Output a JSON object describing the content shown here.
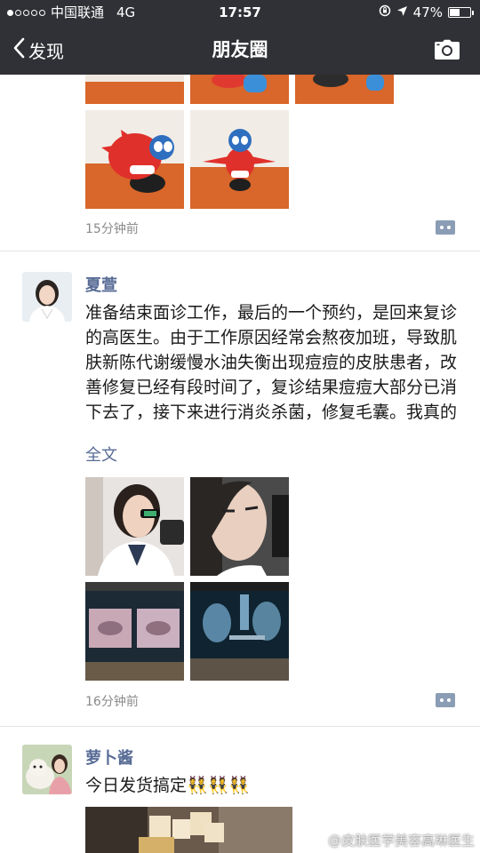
{
  "status_bar": {
    "carrier": "中国联通",
    "network": "4G",
    "time": "17:57",
    "battery": "47%"
  },
  "nav": {
    "back_label": "发现",
    "title": "朋友圈"
  },
  "posts": [
    {
      "time": "15分钟前"
    },
    {
      "author": "夏萱",
      "text": "准备结束面诊工作，最后的一个预约，是回来复诊的高医生。由于工作原因经常会熬夜加班，导致肌肤新陈代谢缓慢水油失衡出现痘痘的皮肤患者，改善修复已经有段时间了，复诊结果痘痘大部分已消下去了，接下来进行消炎杀菌，修复毛囊。我真的很欣赏她这份毅力",
      "more_label": "全文",
      "time": "16分钟前"
    },
    {
      "author": "萝卜酱",
      "text": "今日发货搞定"
    }
  ],
  "watermark": "@皮肤医学美容高琳医生",
  "colors": {
    "bar_bg": "#2f3136",
    "link": "#576b95"
  }
}
